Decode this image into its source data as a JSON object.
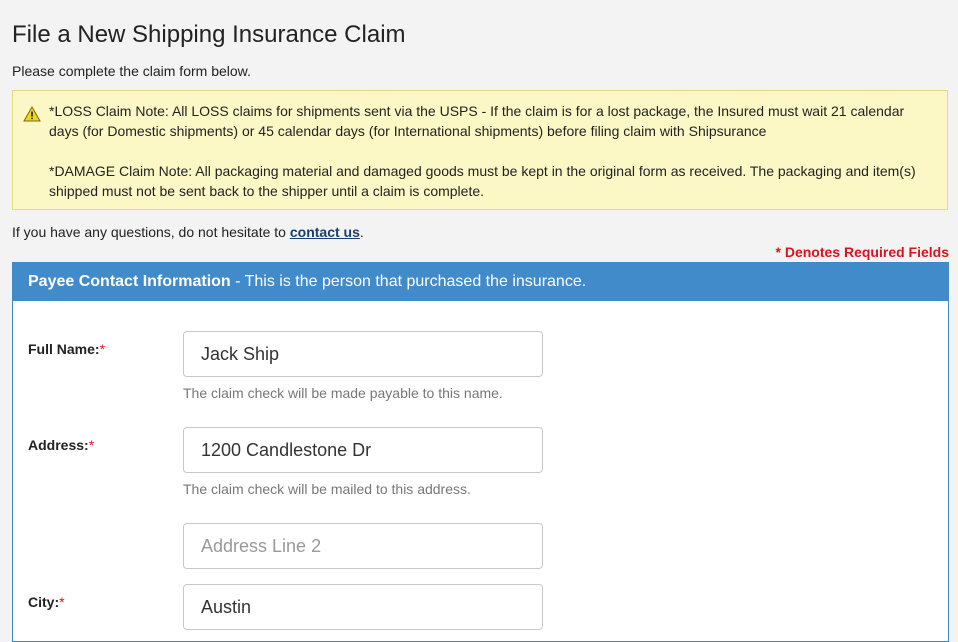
{
  "page": {
    "title": "File a New Shipping Insurance Claim",
    "subtitle": "Please complete the claim form below."
  },
  "notice": {
    "icon": "warning-icon",
    "loss_note": "*LOSS Claim Note: All LOSS claims for shipments sent via the USPS - If the claim is for a lost package, the Insured must wait 21 calendar days (for Domestic shipments) or 45 calendar days (for International shipments) before filing claim with Shipsurance",
    "damage_note": "*DAMAGE Claim Note: All packaging material and damaged goods must be kept in the original form as received. The packaging and item(s) shipped must not be sent back to the shipper until a claim is complete."
  },
  "questions": {
    "prefix": "If you have any questions, do not hesitate to ",
    "link_label": "contact us",
    "suffix": "."
  },
  "required_note": "* Denotes Required Fields",
  "panel": {
    "title_bold": "Payee Contact Information",
    "title_rest": " - This is the person that purchased the insurance."
  },
  "fields": {
    "full_name": {
      "label": "Full Name:",
      "required_mark": "*",
      "value": "Jack Ship",
      "help": "The claim check will be made payable to this name."
    },
    "address": {
      "label": "Address:",
      "required_mark": "*",
      "value": "1200 Candlestone Dr",
      "help": "The claim check will be mailed to this address."
    },
    "address2": {
      "placeholder": "Address Line 2"
    },
    "city": {
      "label": "City:",
      "required_mark": "*",
      "value": "Austin"
    }
  },
  "colors": {
    "panel_header": "#428bca",
    "required": "#d8141e",
    "notice_bg": "#fcf8c5",
    "link": "#1b3d73"
  }
}
